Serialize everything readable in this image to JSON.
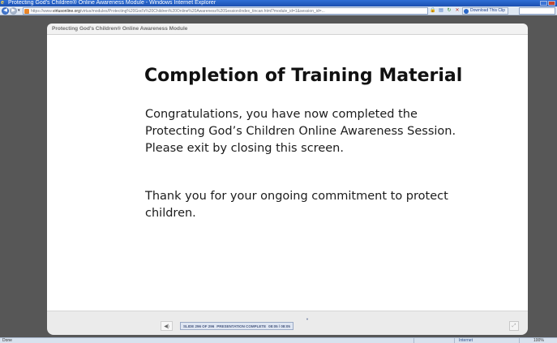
{
  "window": {
    "title": "Protecting God's Children® Online Awareness Module - Windows Internet Explorer"
  },
  "addressbar": {
    "url_prefix": "https://www.",
    "url_host": "virtusonline.org",
    "url_rest": "/virtus/modules/Protecting%20God's%20Children%20Online%20Awareness%20Session/index_tincan.html?module_id=1&session_id=...",
    "download_label": "Download This Clip"
  },
  "module": {
    "header": "Protecting God's Children® Online Awareness Module"
  },
  "slide": {
    "title": "Completion of Training Material",
    "paragraph1": "Congratulations, you have now completed the Protecting God’s Children Online Awareness Session. Please exit by closing this screen.",
    "paragraph2": "Thank you for your ongoing commitment to protect children."
  },
  "player": {
    "slide_counter": "SLIDE 296 OF 296",
    "status": "PRESENTATION COMPLETE",
    "time": "08:05 / 08:05"
  },
  "statusbar": {
    "left_text": "Done",
    "zone": "Internet",
    "zoom": "100%"
  },
  "icons": {
    "back": "back-arrow-icon",
    "forward": "forward-arrow-icon",
    "lock": "lock-icon",
    "refresh": "refresh-icon",
    "stop": "stop-icon",
    "mute": "speaker-icon",
    "expand": "fullscreen-icon"
  }
}
